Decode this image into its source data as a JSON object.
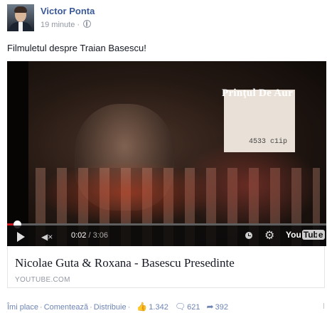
{
  "post": {
    "author": "Victor Ponta",
    "timestamp": "19 minute",
    "privacy_icon": "globe-icon",
    "text": "Filmuletul despre Traian Basescu!"
  },
  "video": {
    "overlay_title": "Prinţul De Aur",
    "overlay_code": "4533 c1ip",
    "current_time": "0:02",
    "separator": "/",
    "total_time": "3:06",
    "progress_fraction": 0.011,
    "logo_you": "You",
    "logo_tube": "Tube",
    "accent_color": "#cc181e"
  },
  "link": {
    "title": "Nicolae Guta & Roxana - Basescu Presedinte",
    "domain": "YOUTUBE.COM"
  },
  "actions": {
    "like_label": "Îmi place",
    "comment_label": "Comentează",
    "share_label": "Distribuie",
    "likes_count": "1.342",
    "comments_count": "621",
    "shares_count": "392"
  }
}
